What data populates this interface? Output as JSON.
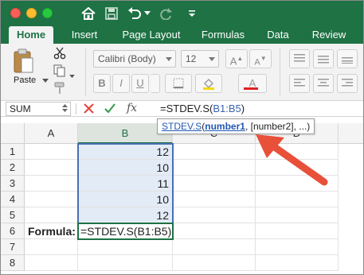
{
  "ribbon_tabs": [
    "Home",
    "Insert",
    "Page Layout",
    "Formulas",
    "Data",
    "Review"
  ],
  "ribbon": {
    "paste_label": "Paste",
    "font_name": "Calibri (Body)",
    "font_size": "12",
    "bold": "B",
    "italic": "I",
    "underline": "U",
    "font_color_glyph": "A",
    "grow_font": "A",
    "shrink_font": "A"
  },
  "formula_bar": {
    "name_box": "SUM",
    "fx": "fx",
    "formula": "=STDEV.S(B1:B5)",
    "formula_prefix": "=STDEV.S(",
    "formula_range": "B1:B5",
    "formula_suffix": ")"
  },
  "tooltip": {
    "fn": "STDEV.S",
    "open": "(",
    "arg1": "number1",
    "rest": ", [number2], ...)"
  },
  "columns": [
    "A",
    "B",
    "C",
    "D"
  ],
  "rows": [
    "1",
    "2",
    "3",
    "4",
    "5",
    "6",
    "7",
    "8"
  ],
  "cells": {
    "B1": "12",
    "B2": "10",
    "B3": "11",
    "B4": "10",
    "B5": "12",
    "A6": "Formula:",
    "B6": "=STDEV.S(B1:B5)"
  },
  "colors": {
    "excel_green": "#1e7244",
    "range_blue": "#4a6fb5",
    "annotation_arrow": "#e8503a"
  }
}
